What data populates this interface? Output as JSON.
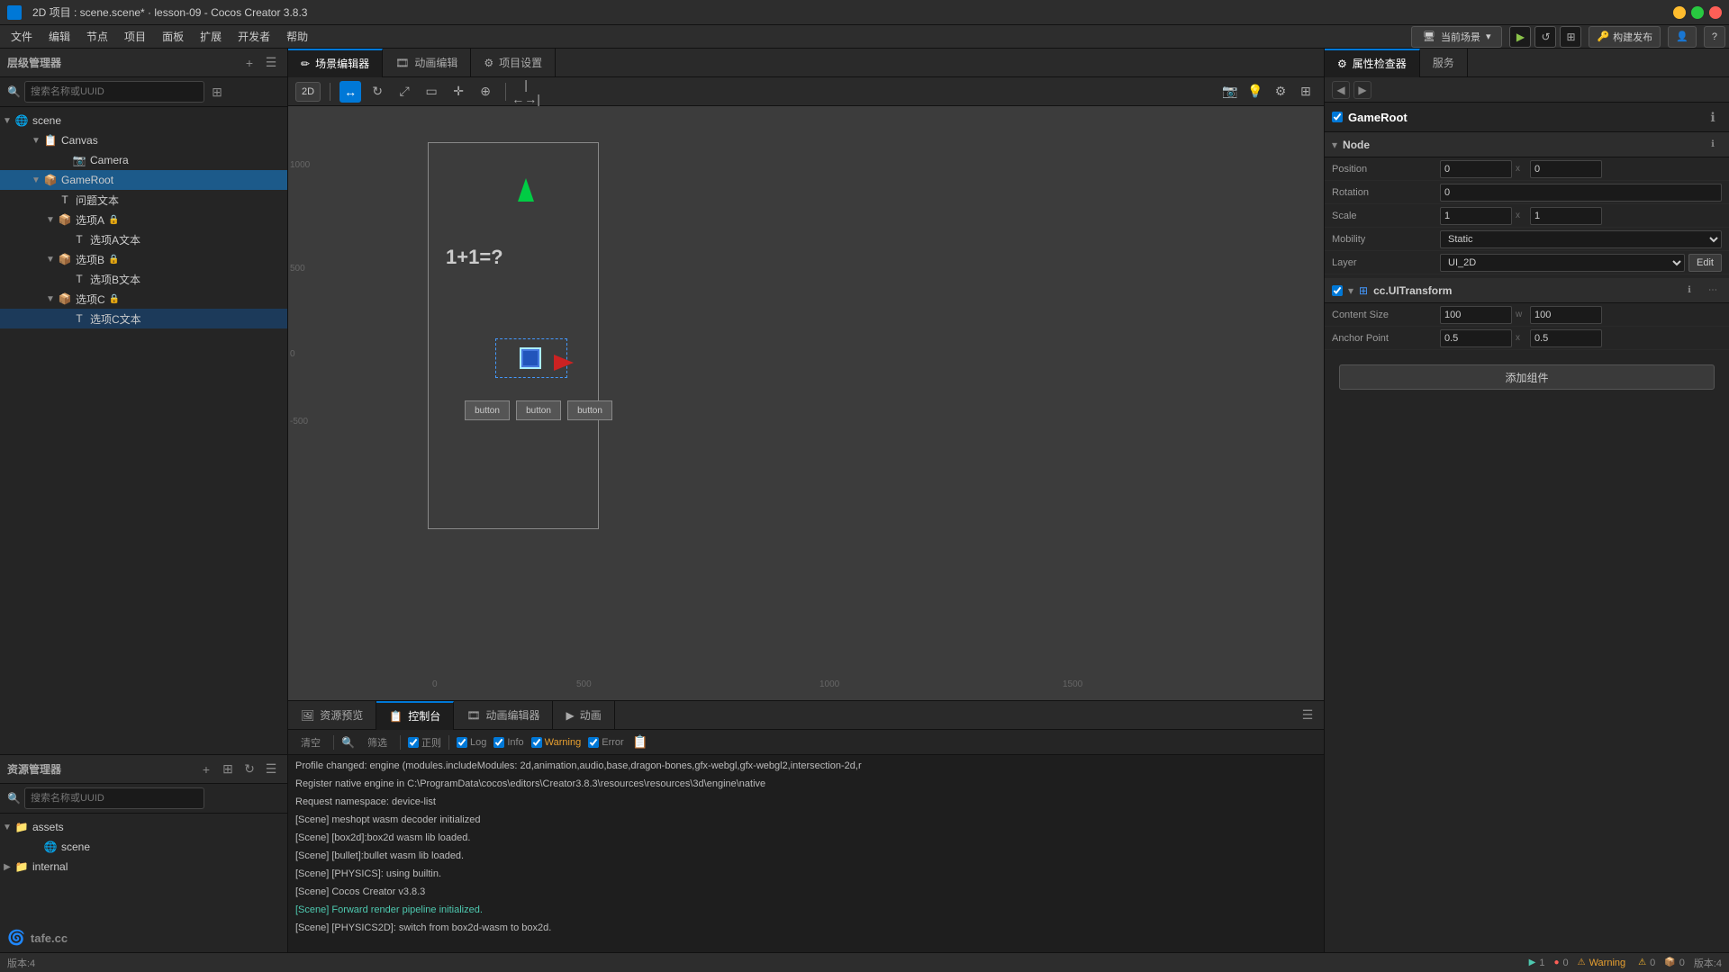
{
  "window": {
    "title": "2D 项目 : scene.scene* · lesson-09 - Cocos Creator 3.8.3"
  },
  "title_bar": {
    "title": "2D 项目 : scene.scene* · lesson-09 - Cocos Creator 3.8.3"
  },
  "menu": {
    "items": [
      "文件",
      "编辑",
      "节点",
      "项目",
      "面板",
      "扩展",
      "开发者",
      "帮助"
    ]
  },
  "toolbar": {
    "mode_label": "当前场景",
    "build_label": "构建发布",
    "play_label": "▶",
    "reload_label": "↺",
    "maximize_label": "⊞"
  },
  "hierarchy": {
    "title": "层级管理器",
    "search_placeholder": "搜索名称或UUID",
    "tree": [
      {
        "id": "scene",
        "label": "scene",
        "depth": 0,
        "type": "scene",
        "expanded": true
      },
      {
        "id": "canvas",
        "label": "Canvas",
        "depth": 1,
        "type": "node",
        "expanded": true
      },
      {
        "id": "camera",
        "label": "Camera",
        "depth": 2,
        "type": "node"
      },
      {
        "id": "gameroot",
        "label": "GameRoot",
        "depth": 2,
        "type": "node",
        "expanded": true,
        "selected": true
      },
      {
        "id": "question",
        "label": "问题文本",
        "depth": 3,
        "type": "node"
      },
      {
        "id": "optiona",
        "label": "选项A",
        "depth": 3,
        "type": "node",
        "expanded": true
      },
      {
        "id": "optionAtext",
        "label": "选项A文本",
        "depth": 4,
        "type": "node"
      },
      {
        "id": "optionb",
        "label": "选项B",
        "depth": 3,
        "type": "node",
        "expanded": true
      },
      {
        "id": "optionBtext",
        "label": "选项B文本",
        "depth": 4,
        "type": "node"
      },
      {
        "id": "optionc",
        "label": "选项C",
        "depth": 3,
        "type": "node",
        "expanded": true
      },
      {
        "id": "optionCtext",
        "label": "选项C文本",
        "depth": 4,
        "type": "node",
        "selected_row": true
      }
    ]
  },
  "assets": {
    "title": "资源管理器",
    "search_placeholder": "搜索名称或UUID",
    "tree": [
      {
        "id": "assets",
        "label": "assets",
        "depth": 0,
        "type": "folder",
        "expanded": true
      },
      {
        "id": "scene_asset",
        "label": "scene",
        "depth": 1,
        "type": "scene"
      },
      {
        "id": "internal",
        "label": "internal",
        "depth": 0,
        "type": "folder",
        "expanded": false
      }
    ]
  },
  "scene_editor": {
    "tabs": [
      "场景编辑器",
      "动画编辑",
      "项目设置"
    ],
    "active_tab": "场景编辑器",
    "mode_2d": "2D",
    "tools": [
      "move",
      "rotate",
      "scale",
      "rect",
      "transform",
      "anchor"
    ],
    "grid_numbers": {
      "top_left": "1000",
      "mid_left": "500",
      "bottom": "-500",
      "right_1": "500",
      "right_2": "1000",
      "right_3": "1500",
      "center_top": "0",
      "center_bottom": "0"
    },
    "question_text": "1+1=?",
    "button_label": "button"
  },
  "inspector": {
    "tabs": [
      "属性检查器",
      "服务"
    ],
    "active_tab": "属性检查器",
    "node_name": "GameRoot",
    "sections": {
      "node": {
        "title": "Node",
        "position": {
          "x": "0",
          "y": "0"
        },
        "rotation": "0",
        "scale": {
          "x": "1",
          "y": "1"
        },
        "mobility": "Static",
        "layer": "UI_2D"
      },
      "transform": {
        "title": "cc.UITransform",
        "content_size": {
          "w": "100",
          "h": "100"
        },
        "anchor_point": {
          "x": "0.5",
          "y": "0.5"
        }
      }
    },
    "add_component_label": "添加组件"
  },
  "console": {
    "tabs": [
      "资源预览",
      "控制台",
      "动画编辑器",
      "动画"
    ],
    "active_tab": "控制台",
    "filters": {
      "clear": "清空",
      "search": "筛选",
      "normal": "正则",
      "log_label": "Log",
      "info_label": "Info",
      "warning_label": "Warning",
      "error_label": "Error"
    },
    "messages": [
      {
        "text": "Profile changed: engine (modules.includeModules: 2d,animation,audio,base,dragon-bones,gfx-webgl,gfx-webgl2,intersection-2d,r",
        "type": "normal"
      },
      {
        "text": "Register native engine in C:\\ProgramData\\cocos\\editors\\Creator3.8.3\\resources\\resources\\3d\\engine\\native",
        "type": "normal"
      },
      {
        "text": "Request namespace: device-list",
        "type": "normal"
      },
      {
        "text": "[Scene] meshopt wasm decoder initialized",
        "type": "normal"
      },
      {
        "text": "[Scene] [box2d]:box2d wasm lib loaded.",
        "type": "normal"
      },
      {
        "text": "[Scene] [bullet]:bullet wasm lib loaded.",
        "type": "normal"
      },
      {
        "text": "[Scene] [PHYSICS]: using builtin.",
        "type": "normal"
      },
      {
        "text": "[Scene] Cocos Creator v3.8.3",
        "type": "normal"
      },
      {
        "text": "[Scene] Forward render pipeline initialized.",
        "type": "highlight"
      },
      {
        "text": "[Scene] [PHYSICS2D]: switch from box2d-wasm to box2d.",
        "type": "normal"
      }
    ]
  },
  "status_bar": {
    "warning_label": "Warning",
    "version": "版本:4",
    "counts": {
      "p1": "▶ 1",
      "p2": "🔴 0",
      "p3": "⚠ 0",
      "p4": "🟡 0",
      "p5": "📦 0"
    }
  },
  "watermark": {
    "text": "tafe.cc"
  }
}
